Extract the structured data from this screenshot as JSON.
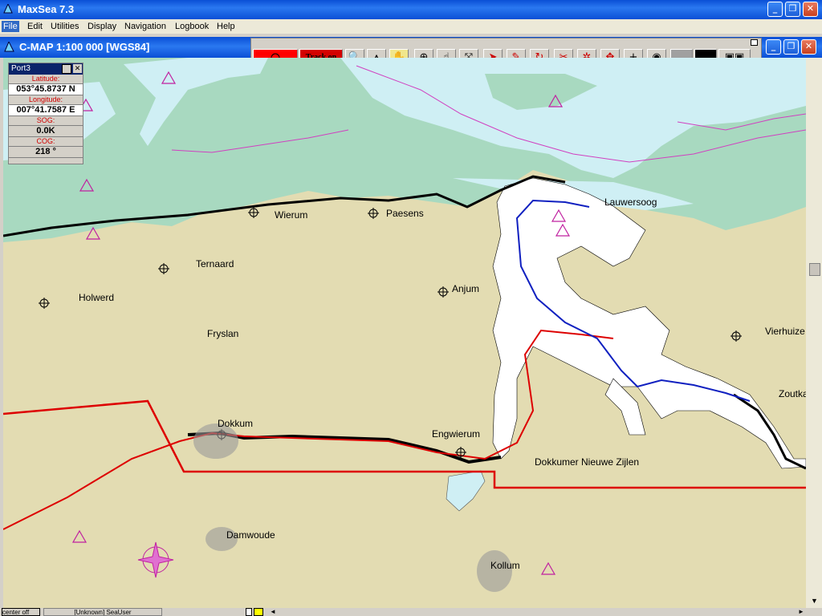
{
  "app": {
    "title": "MaxSea 7.3"
  },
  "menu": {
    "items": [
      "File",
      "Edit",
      "Utilities",
      "Display",
      "Navigation",
      "Logbook",
      "Help"
    ],
    "active": "File"
  },
  "chart_window": {
    "title": "C-MAP  1:100 000 [WGS84]"
  },
  "toolbar": {
    "track_label": "Track on"
  },
  "port_panel": {
    "title": "Port3",
    "latitude_label": "Latitude:",
    "latitude": "053°45.8737 N",
    "longitude_label": "Longitude:",
    "longitude": "007°41.7587 E",
    "sog_label": "SOG:",
    "sog": "0.0K",
    "cog_label": "COG:",
    "cog": "218 °"
  },
  "places": {
    "wierum": "Wierum",
    "paesens": "Paesens",
    "lauwersoog": "Lauwersoog",
    "ternaard": "Ternaard",
    "holwerd": "Holwerd",
    "anjum": "Anjum",
    "fryslan": "Fryslan",
    "vierhuize": "Vierhuize",
    "zoutka": "Zoutka",
    "dokkum": "Dokkum",
    "engwierum": "Engwierum",
    "dokkumer": "Dokkumer Nieuwe Zijlen",
    "damwoude": "Damwoude",
    "kollum": "Kollum"
  },
  "status": {
    "left": "center off",
    "user": "[Unknown] SeaUser"
  },
  "colors": {
    "sea": "#a8d9c0",
    "land": "#e3dcb2",
    "shallow": "#cfeff4",
    "route": "#dd0000",
    "track": "#1020c0",
    "hazard": "#c020a0"
  }
}
